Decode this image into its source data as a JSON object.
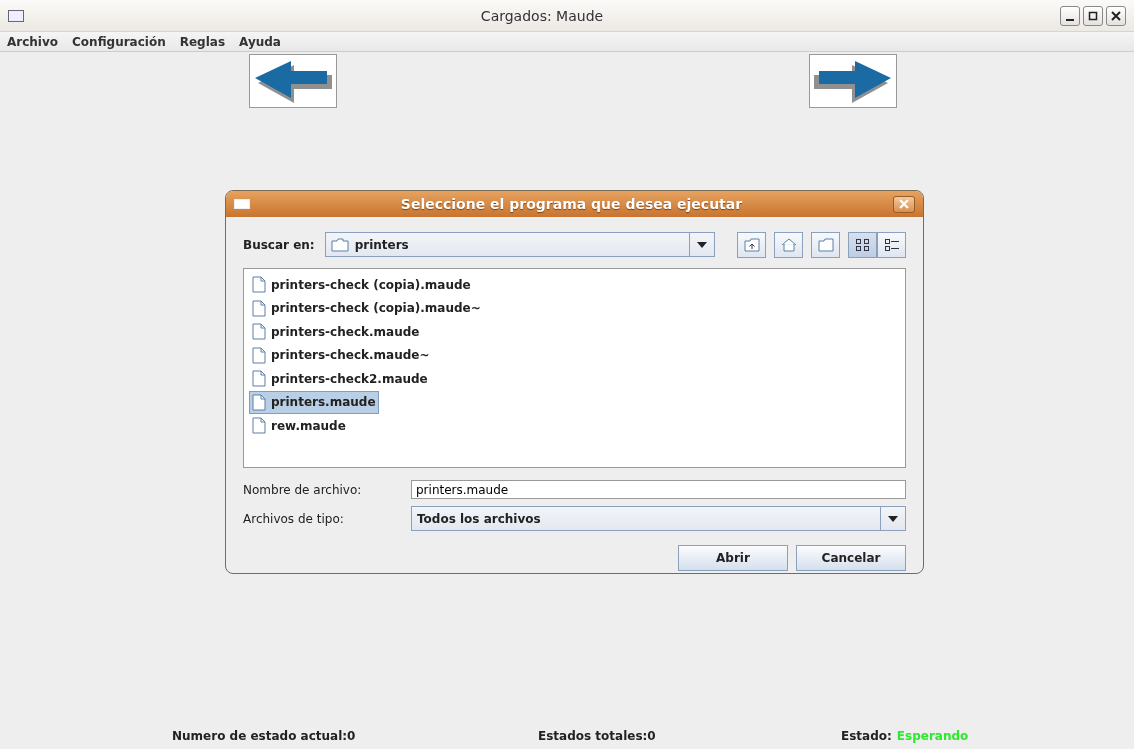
{
  "window": {
    "title": "Cargados: Maude"
  },
  "menu": [
    "Archivo",
    "Configuración",
    "Reglas",
    "Ayuda"
  ],
  "dialog": {
    "title": "Seleccione el programa que desea ejecutar",
    "look_in": {
      "label": "Buscar en:",
      "value": "printers"
    },
    "files": [
      {
        "name": "printers-check (copia).maude",
        "selected": false
      },
      {
        "name": "printers-check (copia).maude~",
        "selected": false
      },
      {
        "name": "printers-check.maude",
        "selected": false
      },
      {
        "name": "printers-check.maude~",
        "selected": false
      },
      {
        "name": "printers-check2.maude",
        "selected": false
      },
      {
        "name": "printers.maude",
        "selected": true
      },
      {
        "name": "rew.maude",
        "selected": false
      }
    ],
    "file_name": {
      "label": "Nombre de archivo:",
      "value": "printers.maude"
    },
    "file_type": {
      "label": "Archivos de tipo:",
      "value": "Todos los archivos"
    },
    "buttons": [
      "Abrir",
      "Cancelar"
    ]
  },
  "status_bar": {
    "current_state": "Numero de estado actual:0",
    "total_states": "Estados totales:0",
    "state_label": "Estado:",
    "state_value": "Esperando"
  }
}
